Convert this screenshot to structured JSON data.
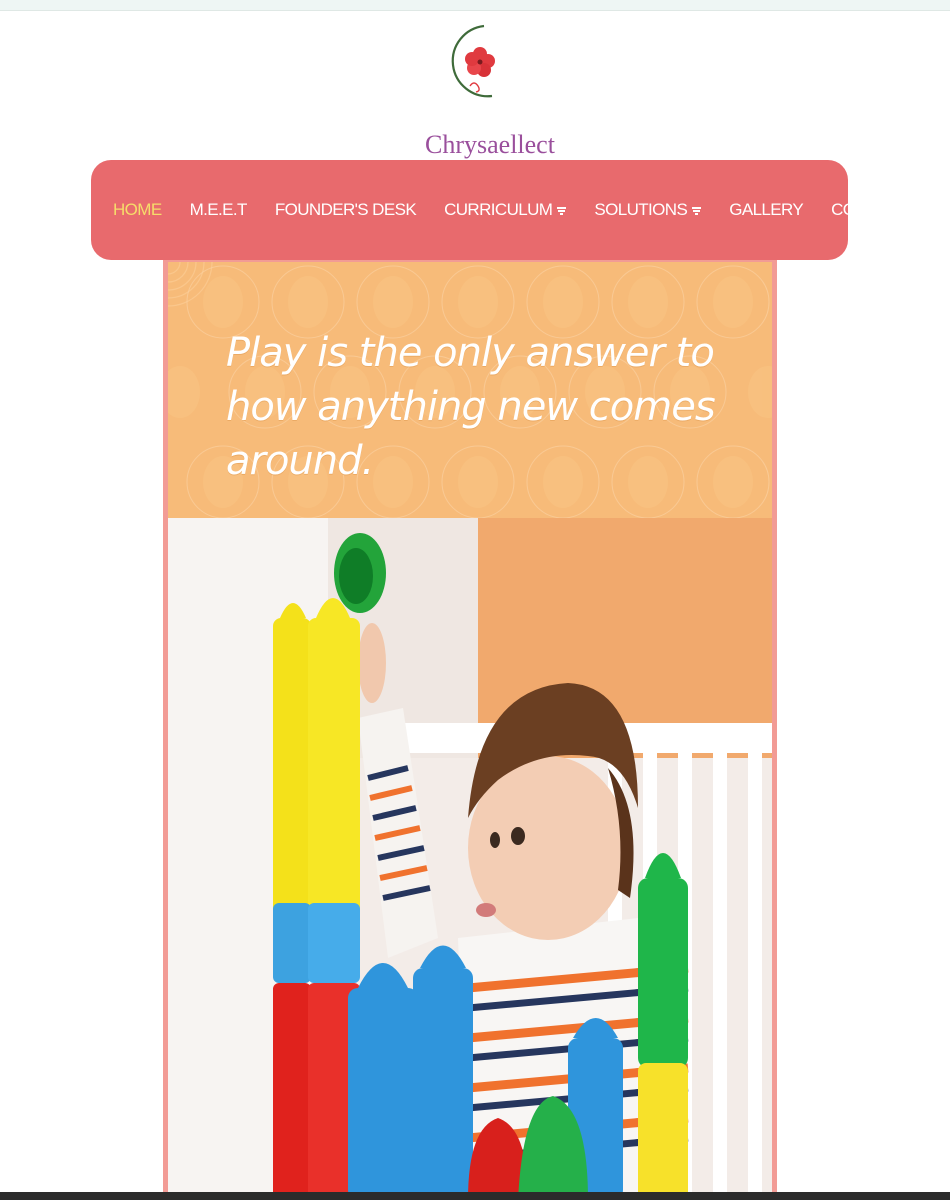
{
  "brand": {
    "name": "Chrysaellect"
  },
  "nav": {
    "items": [
      {
        "label": "HOME",
        "active": true,
        "dropdown": false
      },
      {
        "label": "M.E.E.T",
        "active": false,
        "dropdown": false
      },
      {
        "label": "FOUNDER'S DESK",
        "active": false,
        "dropdown": false
      },
      {
        "label": "CURRICULUM",
        "active": false,
        "dropdown": true
      },
      {
        "label": "SOLUTIONS",
        "active": false,
        "dropdown": true
      },
      {
        "label": "GALLERY",
        "active": false,
        "dropdown": false
      },
      {
        "label": "CONTACT US",
        "active": false,
        "dropdown": false
      }
    ]
  },
  "banner": {
    "quote": "Play is the only answer to how anything new comes around."
  },
  "colors": {
    "nav_background": "#e86a6d",
    "nav_active": "#f6dc6a",
    "banner_background": "#f7bb79",
    "frame": "#f29b95",
    "brand_text": "#9a4f9c"
  }
}
